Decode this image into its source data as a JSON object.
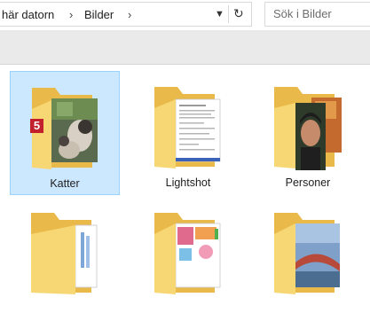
{
  "address_bar": {
    "breadcrumbs": [
      "här datorn",
      "Bilder"
    ],
    "search_placeholder": "Sök i Bilder"
  },
  "items": [
    {
      "label": "Katter",
      "badge": "5",
      "selected": true
    },
    {
      "label": "Lightshot",
      "selected": false
    },
    {
      "label": "Personer",
      "selected": false
    },
    {
      "label": "",
      "selected": false
    },
    {
      "label": "",
      "selected": false
    },
    {
      "label": "",
      "selected": false
    }
  ],
  "colors": {
    "folder": "#f7d774",
    "folder_dark": "#e9b94a",
    "selection": "#cce8ff",
    "selection_border": "#99d1ff",
    "badge": "#c2202d"
  }
}
